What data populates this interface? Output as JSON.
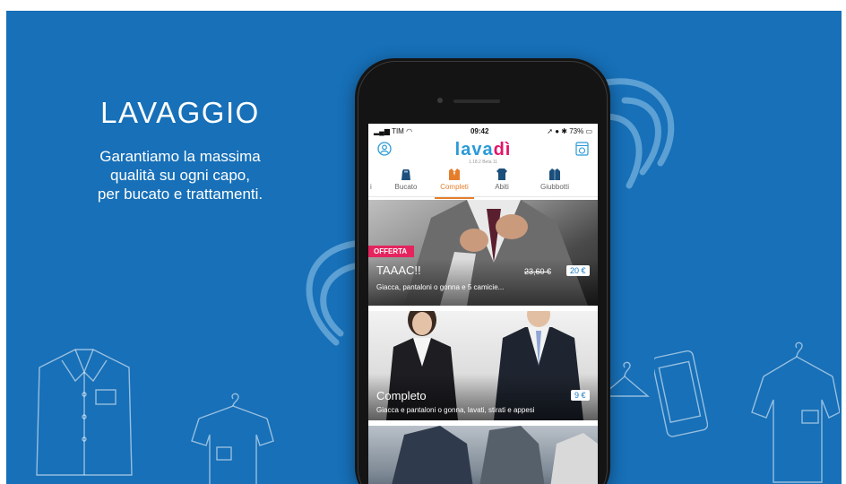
{
  "promo": {
    "title": "LAVAGGIO",
    "tagline": [
      "Garantiamo la massima",
      "qualità su ogni capo,",
      "per bucato e trattamenti."
    ]
  },
  "status_bar": {
    "carrier": "TIM",
    "time": "09:42",
    "battery": "73%"
  },
  "app": {
    "logo_main": "lava",
    "logo_accent": "dì",
    "version": "1.18.2 Beta 11"
  },
  "tabs": [
    {
      "label": "i",
      "icon": "partial-tab-icon",
      "active": false
    },
    {
      "label": "Bucato",
      "icon": "laundry-bag-icon",
      "active": false
    },
    {
      "label": "Completi",
      "icon": "suit-icon",
      "active": true
    },
    {
      "label": "Abiti",
      "icon": "shirt-icon",
      "active": false
    },
    {
      "label": "Giubbotti",
      "icon": "jacket-icon",
      "active": false
    }
  ],
  "cards": [
    {
      "badge": "OFFERTA",
      "title": "TAAAC!!",
      "description": "Giacca, pantaloni o gonna e 5 camicie...",
      "old_price": "23,60 €",
      "price": "20 €"
    },
    {
      "title": "Completo",
      "description": "Giacca e pantaloni o gonna, lavati, stirati e appesi",
      "price": "9 €"
    }
  ],
  "colors": {
    "background": "#1770b8",
    "accent_orange": "#e57e2c",
    "badge_pink": "#e5245e",
    "logo_blue": "#2a9ad8"
  }
}
